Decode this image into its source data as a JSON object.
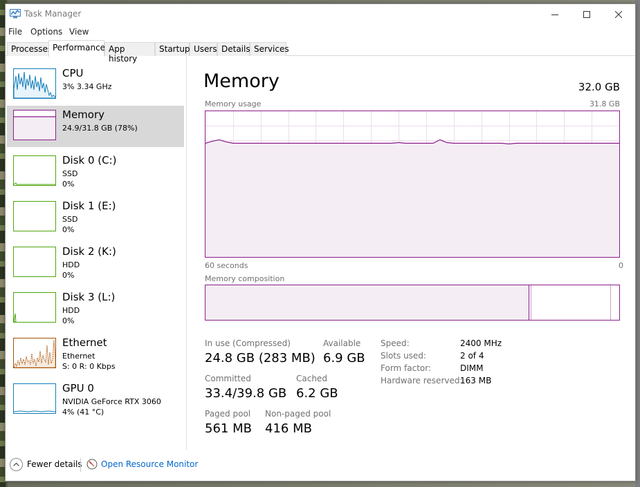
{
  "window": {
    "title": "Task Manager"
  },
  "menu": [
    "File",
    "Options",
    "View"
  ],
  "tabs": [
    "Processes",
    "Performance",
    "App history",
    "Startup",
    "Users",
    "Details",
    "Services"
  ],
  "sidebar": [
    {
      "name": "CPU",
      "line1": "3% 3.34 GHz",
      "line2": "",
      "color": "#117dbb"
    },
    {
      "name": "Memory",
      "line1": "24.9/31.8 GB (78%)",
      "line2": "",
      "color": "#8b1c8b"
    },
    {
      "name": "Disk 0 (C:)",
      "line1": "SSD",
      "line2": "0%",
      "color": "#4da60c"
    },
    {
      "name": "Disk 1 (E:)",
      "line1": "SSD",
      "line2": "0%",
      "color": "#4da60c"
    },
    {
      "name": "Disk 2 (K:)",
      "line1": "HDD",
      "line2": "0%",
      "color": "#4da60c"
    },
    {
      "name": "Disk 3 (L:)",
      "line1": "HDD",
      "line2": "0%",
      "color": "#4da60c"
    },
    {
      "name": "Ethernet",
      "line1": "Ethernet",
      "line2": "S: 0 R: 0 Kbps",
      "color": "#a74f01"
    },
    {
      "name": "GPU 0",
      "line1": "NVIDIA GeForce RTX 3060",
      "line2": "4% (41 °C)",
      "color": "#117dbb"
    }
  ],
  "main": {
    "title": "Memory",
    "total": "32.0 GB",
    "usage_label": "Memory usage",
    "usage_max": "31.8 GB",
    "time_left": "60 seconds",
    "time_right": "0",
    "composition_label": "Memory composition",
    "usage_fraction": 0.78,
    "stats": {
      "in_use_label": "In use (Compressed)",
      "in_use_value": "24.8 GB (283 MB)",
      "available_label": "Available",
      "available_value": "6.9 GB",
      "committed_label": "Committed",
      "committed_value": "33.4/39.8 GB",
      "cached_label": "Cached",
      "cached_value": "6.2 GB",
      "paged_label": "Paged pool",
      "paged_value": "561 MB",
      "nonpaged_label": "Non-paged pool",
      "nonpaged_value": "416 MB"
    },
    "details": [
      {
        "label": "Speed:",
        "value": "2400 MHz"
      },
      {
        "label": "Slots used:",
        "value": "2 of 4"
      },
      {
        "label": "Form factor:",
        "value": "DIMM"
      },
      {
        "label": "Hardware reserved:",
        "value": "163 MB"
      }
    ]
  },
  "footer": {
    "fewer": "Fewer details",
    "open_rm": "Open Resource Monitor"
  },
  "colors": {
    "memory": "#8b1c8b",
    "memory_fill": "#f4eef4",
    "link": "#0066cc"
  }
}
